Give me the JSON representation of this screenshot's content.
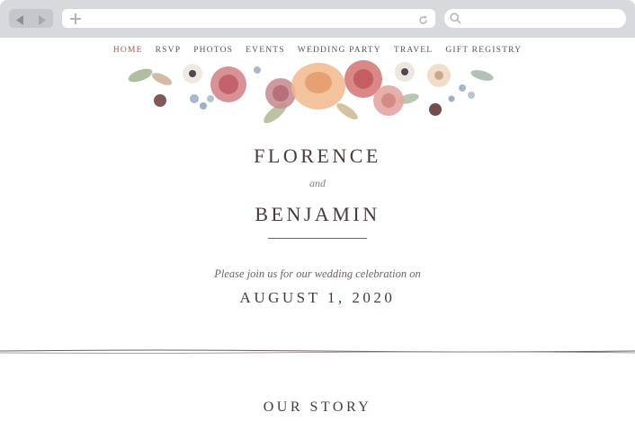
{
  "nav": {
    "items": [
      {
        "label": "HOME",
        "active": true
      },
      {
        "label": "RSVP",
        "active": false
      },
      {
        "label": "PHOTOS",
        "active": false
      },
      {
        "label": "EVENTS",
        "active": false
      },
      {
        "label": "WEDDING PARTY",
        "active": false
      },
      {
        "label": "TRAVEL",
        "active": false
      },
      {
        "label": "GIFT REGISTRY",
        "active": false
      }
    ]
  },
  "hero": {
    "name1": "FLORENCE",
    "connector": "and",
    "name2": "BENJAMIN",
    "invite": "Please join us for our wedding celebration on",
    "date": "AUGUST 1, 2020"
  },
  "story": {
    "title": "OUR STORY"
  },
  "colors": {
    "accent": "#b5533d",
    "text": "#4a3b3a",
    "chrome": "#d8d9dc"
  }
}
